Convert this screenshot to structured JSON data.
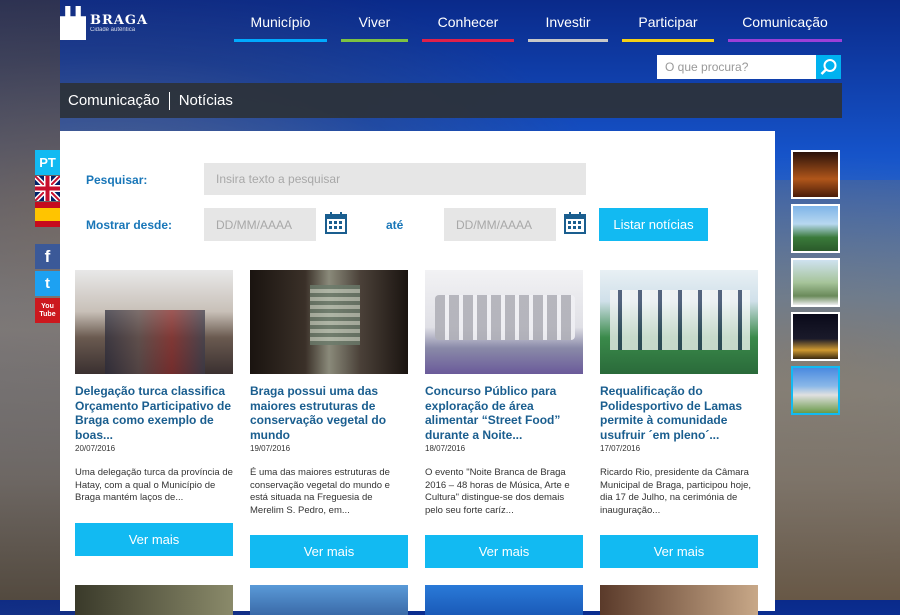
{
  "logo": {
    "name": "BRAGA",
    "tagline": "Cidade autêntica"
  },
  "nav": [
    {
      "label": "Município",
      "color": "#00aaff"
    },
    {
      "label": "Viver",
      "color": "#7dc242"
    },
    {
      "label": "Conhecer",
      "color": "#e0204a"
    },
    {
      "label": "Investir",
      "color": "#c8c8c8"
    },
    {
      "label": "Participar",
      "color": "#f5d016"
    },
    {
      "label": "Comunicação",
      "color": "#9b3fd8"
    }
  ],
  "search": {
    "placeholder": "O que procura?",
    "icon": "search-icon"
  },
  "breadcrumb": {
    "section": "Comunicação",
    "page": "Notícias"
  },
  "filters": {
    "search_label": "Pesquisar:",
    "search_placeholder": "Insira texto a pesquisar",
    "from_label": "Mostrar desde:",
    "date_placeholder": "DD/MM/AAAA",
    "to_label": "até",
    "list_button": "Listar notícias"
  },
  "language": {
    "current": "PT",
    "others": [
      "en-flag-icon",
      "es-flag-icon"
    ]
  },
  "social": [
    {
      "name": "facebook-icon",
      "glyph": "f",
      "color": "#3b5998"
    },
    {
      "name": "twitter-icon",
      "glyph": "t",
      "color": "#1da1f2"
    },
    {
      "name": "youtube-icon",
      "glyph": "You Tube",
      "color": "#cc181e"
    }
  ],
  "news": [
    {
      "title": "Delegação turca classifica Orçamento Participativo de Braga como exemplo de boas...",
      "date": "20/07/2016",
      "excerpt": "Uma delegação turca da província de Hatay, com a qual o Município de Braga mantém laços de...",
      "button": "Ver mais"
    },
    {
      "title": "Braga possui uma das maiores estruturas de conservação vegetal do mundo",
      "date": "19/07/2016",
      "excerpt": "É uma das maiores estruturas de conservação vegetal do mundo e está situada na Freguesia de Merelim S. Pedro, em...",
      "button": "Ver mais"
    },
    {
      "title": "Concurso Público para exploração de área alimentar “Street Food” durante a Noite...",
      "date": "18/07/2016",
      "excerpt": "O evento \"Noite Branca de Braga 2016 – 48 horas de Música, Arte e Cultura\" distingue-se dos demais pelo seu forte caríz...",
      "button": "Ver mais"
    },
    {
      "title": "Requalificação do Polidesportivo de Lamas permite à comunidade usufruir ´em pleno´...",
      "date": "17/07/2016",
      "excerpt": "Ricardo Rio, presidente da Câmara Municipal de Braga, participou hoje, dia 17 de Julho, na cerimónia de inauguração...",
      "button": "Ver mais"
    }
  ]
}
